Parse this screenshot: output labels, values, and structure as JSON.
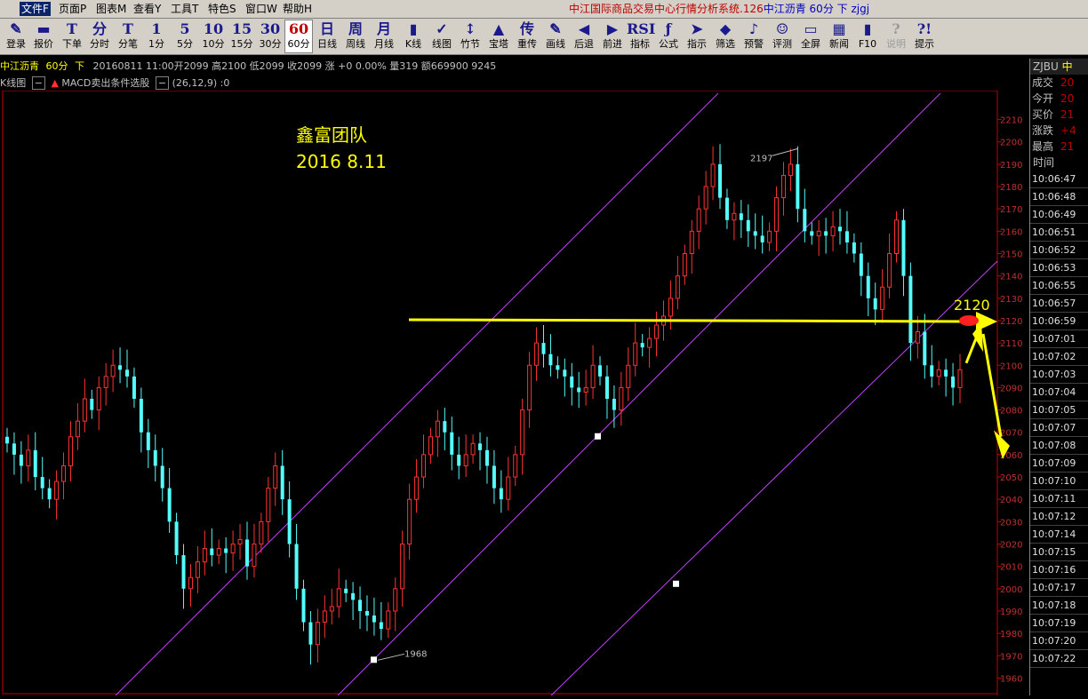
{
  "menu": [
    {
      "label": "文件F",
      "active": true
    },
    {
      "label": "页面P"
    },
    {
      "label": "图表M"
    },
    {
      "label": "查看Y"
    },
    {
      "label": "工具T"
    },
    {
      "label": "特色S"
    },
    {
      "label": "窗口W"
    },
    {
      "label": "帮助H"
    }
  ],
  "app_title": {
    "main": "中江国际商品交易中心行情分析系统.126",
    "sub": "中江沥青  60分  下  zjgj"
  },
  "toolbar": [
    {
      "icon": "✎",
      "label": "登录"
    },
    {
      "icon": "▬",
      "label": "报价"
    },
    {
      "icon": "T",
      "label": "下单"
    },
    {
      "icon": "分",
      "label": "分时"
    },
    {
      "icon": "T",
      "label": "分笔"
    },
    {
      "icon": "1",
      "label": "1分"
    },
    {
      "icon": "5",
      "label": "5分"
    },
    {
      "icon": "10",
      "label": "10分"
    },
    {
      "icon": "15",
      "label": "15分"
    },
    {
      "icon": "30",
      "label": "30分"
    },
    {
      "icon": "60",
      "label": "60分",
      "selected": true
    },
    {
      "icon": "日",
      "label": "日线"
    },
    {
      "icon": "周",
      "label": "周线"
    },
    {
      "icon": "月",
      "label": "月线"
    },
    {
      "icon": "▮",
      "label": "K线"
    },
    {
      "icon": "✓",
      "label": "线图"
    },
    {
      "icon": "↕",
      "label": "竹节"
    },
    {
      "icon": "▲",
      "label": "宝塔"
    },
    {
      "icon": "传",
      "label": "重传"
    },
    {
      "icon": "✎",
      "label": "画线"
    },
    {
      "icon": "◀",
      "label": "后退"
    },
    {
      "icon": "▶",
      "label": "前进"
    },
    {
      "icon": "RSI",
      "label": "指标"
    },
    {
      "icon": "ƒ",
      "label": "公式"
    },
    {
      "icon": "➤",
      "label": "指示"
    },
    {
      "icon": "◆",
      "label": "筛选"
    },
    {
      "icon": "♪",
      "label": "预警"
    },
    {
      "icon": "☺",
      "label": "评测"
    },
    {
      "icon": "▭",
      "label": "全屏"
    },
    {
      "icon": "▦",
      "label": "新闻"
    },
    {
      "icon": "▮",
      "label": "F10"
    },
    {
      "icon": "?",
      "label": "说明",
      "disabled": true
    },
    {
      "icon": "?!",
      "label": "提示"
    }
  ],
  "infobar": {
    "name": "中江沥青",
    "period": "60分",
    "dir": "下",
    "quote": "20160811 11:00开2099 高2100 低2099 收2099 涨 +0 0.00% 量319 额669900 9245"
  },
  "subbar": {
    "kline": "K线图",
    "indicator": "MACD卖出条件选股",
    "params": "(26,12,9) :0"
  },
  "right_panel": {
    "code": "ZJBU",
    "name": "中",
    "fields": [
      {
        "k": "成交",
        "v": "20"
      },
      {
        "k": "今开",
        "v": "20"
      },
      {
        "k": "买价",
        "v": "21"
      },
      {
        "k": "涨跌",
        "v": "+4"
      },
      {
        "k": "最高",
        "v": "21"
      }
    ],
    "time_header": "时间",
    "times": [
      "10:06:47",
      "10:06:48",
      "10:06:49",
      "10:06:51",
      "10:06:52",
      "10:06:53",
      "10:06:55",
      "10:06:57",
      "10:06:59",
      "10:07:01",
      "10:07:02",
      "10:07:03",
      "10:07:04",
      "10:07:05",
      "10:07:07",
      "10:07:08",
      "10:07:09",
      "10:07:10",
      "10:07:11",
      "10:07:12",
      "10:07:14",
      "10:07:15",
      "10:07:16",
      "10:07:17",
      "10:07:18",
      "10:07:19",
      "10:07:20",
      "10:07:22"
    ]
  },
  "annotations": {
    "team": "鑫富团队",
    "date": "2016 8.11",
    "level": "2120",
    "high_label": "2197",
    "low_label": "1968"
  },
  "colors": {
    "up": "#ff3232",
    "down": "#54fcfc",
    "channel": "#c040ff",
    "annotation": "#ffff00",
    "axis": "#c00000"
  },
  "chart_data": {
    "type": "candlestick",
    "interval": "60分",
    "y_axis": {
      "ticks": [
        2210,
        2200,
        2190,
        2180,
        2170,
        2160,
        2150,
        2140,
        2130,
        2120,
        2110,
        2100,
        2090,
        2080,
        2070,
        2060,
        2050,
        2040,
        2030,
        2020,
        2010,
        2000,
        1990,
        1980,
        1970,
        1960
      ]
    },
    "horizontal_line": 2120,
    "extremes": [
      {
        "label": "2197",
        "value": 2197
      },
      {
        "label": "1968",
        "value": 1968
      }
    ],
    "closes": [
      2065,
      2060,
      2055,
      2062,
      2050,
      2045,
      2040,
      2048,
      2055,
      2068,
      2075,
      2085,
      2080,
      2090,
      2095,
      2100,
      2098,
      2095,
      2085,
      2070,
      2062,
      2055,
      2045,
      2030,
      2015,
      2000,
      2005,
      2012,
      2018,
      2015,
      2018,
      2016,
      2020,
      2022,
      2010,
      2020,
      2030,
      2045,
      2055,
      2040,
      2020,
      2000,
      1985,
      1975,
      1985,
      1990,
      1992,
      2000,
      1998,
      1995,
      1990,
      1988,
      1985,
      1982,
      1990,
      2000,
      2020,
      2040,
      2050,
      2060,
      2068,
      2075,
      2070,
      2060,
      2055,
      2060,
      2065,
      2062,
      2055,
      2045,
      2040,
      2050,
      2060,
      2080,
      2100,
      2110,
      2105,
      2100,
      2098,
      2095,
      2090,
      2088,
      2090,
      2100,
      2095,
      2085,
      2080,
      2090,
      2100,
      2110,
      2108,
      2112,
      2118,
      2122,
      2130,
      2140,
      2150,
      2160,
      2170,
      2180,
      2190,
      2175,
      2165,
      2168,
      2165,
      2160,
      2158,
      2155,
      2160,
      2175,
      2185,
      2190,
      2170,
      2160,
      2158,
      2160,
      2158,
      2162,
      2160,
      2155,
      2150,
      2140,
      2130,
      2125,
      2135,
      2150,
      2165,
      2140,
      2110,
      2115,
      2100,
      2095,
      2098,
      2095,
      2090,
      2098
    ]
  }
}
